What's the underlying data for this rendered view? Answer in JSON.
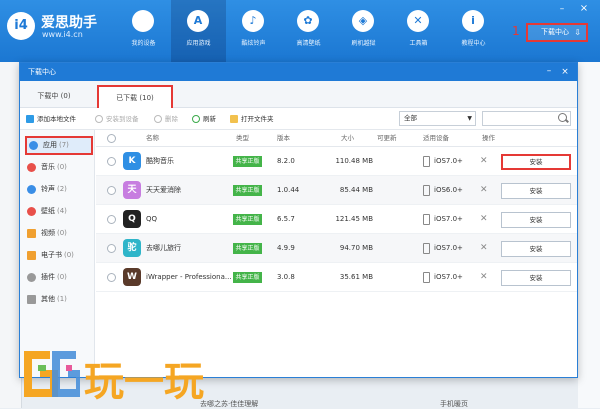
{
  "app": {
    "logo_glyph": "i4",
    "name": "爱思助手",
    "url": "www.i4.cn"
  },
  "nav": [
    {
      "label": "我的设备",
      "icon": "apple-icon",
      "glyph": ""
    },
    {
      "label": "应用游戏",
      "icon": "appstore-icon",
      "glyph": "A"
    },
    {
      "label": "酷炫铃声",
      "icon": "bell-icon",
      "glyph": "♪"
    },
    {
      "label": "高清壁纸",
      "icon": "flower-icon",
      "glyph": "✿"
    },
    {
      "label": "刷机越狱",
      "icon": "dropbox-icon",
      "glyph": "◈"
    },
    {
      "label": "工具箱",
      "icon": "tools-icon",
      "glyph": "✕"
    },
    {
      "label": "教程中心",
      "icon": "info-icon",
      "glyph": "i"
    }
  ],
  "download_center_button": "下载中心",
  "annotations": [
    "1",
    "2",
    "3",
    "4"
  ],
  "dialog": {
    "title": "下载中心",
    "tabs": {
      "downloading": "下载中 (0)",
      "downloaded": "已下载 (10)"
    },
    "toolbar": {
      "add_local": "添加本地文件",
      "install_to_device": "安装到设备",
      "delete": "删除",
      "refresh": "刷新",
      "open_folder": "打开文件夹"
    },
    "filter_value": "全部",
    "search_placeholder": ""
  },
  "categories": [
    {
      "label": "应用",
      "count": "(7)",
      "icon": "app-icon",
      "color": "#3a8ee6"
    },
    {
      "label": "音乐",
      "count": "(0)",
      "icon": "music-icon",
      "color": "#e8504a"
    },
    {
      "label": "铃声",
      "count": "(2)",
      "icon": "bell-icon",
      "color": "#3a8ee6"
    },
    {
      "label": "壁纸",
      "count": "(4)",
      "icon": "wallpaper-icon",
      "color": "#e8504a"
    },
    {
      "label": "视频",
      "count": "(0)",
      "icon": "video-icon",
      "color": "#f0a030"
    },
    {
      "label": "电子书",
      "count": "(0)",
      "icon": "ebook-icon",
      "color": "#f0a030"
    },
    {
      "label": "插件",
      "count": "(0)",
      "icon": "plugin-icon",
      "color": "#999999"
    },
    {
      "label": "其他",
      "count": "(1)",
      "icon": "other-icon",
      "color": "#999999"
    }
  ],
  "table": {
    "headers": {
      "name": "名称",
      "type": "类型",
      "version": "版本",
      "size": "大小",
      "compat": "可更新",
      "device": "适用设备",
      "action": "操作"
    },
    "rows": [
      {
        "icon_glyph": "K",
        "icon_color": "#2f8fe4",
        "name": "酷狗音乐",
        "type": "共享正版",
        "version": "8.2.0",
        "size": "110.48 MB",
        "device": "iOS7.0+",
        "action": "安装"
      },
      {
        "icon_glyph": "天",
        "icon_color": "#c77de0",
        "name": "天天爱消除",
        "type": "共享正版",
        "version": "1.0.44",
        "size": "85.44 MB",
        "device": "iOS6.0+",
        "action": "安装"
      },
      {
        "icon_glyph": "Q",
        "icon_color": "#222222",
        "name": "QQ",
        "type": "共享正版",
        "version": "6.5.7",
        "size": "121.45 MB",
        "device": "iOS7.0+",
        "action": "安装"
      },
      {
        "icon_glyph": "驼",
        "icon_color": "#2fb5c9",
        "name": "去哪儿旅行",
        "type": "共享正版",
        "version": "4.9.9",
        "size": "94.70 MB",
        "device": "iOS7.0+",
        "action": "安装"
      },
      {
        "icon_glyph": "W",
        "icon_color": "#5a3a2a",
        "name": "iWrapper - Professiona...",
        "type": "共享正版",
        "version": "3.0.8",
        "size": "35.61 MB",
        "device": "iOS7.0+",
        "action": "安装"
      }
    ]
  },
  "background_text": {
    "left": "去哪之苏·佳佳理解",
    "right": "手机暖页"
  },
  "watermark": {
    "text": "玩一玩",
    "color": "#f5a623"
  }
}
